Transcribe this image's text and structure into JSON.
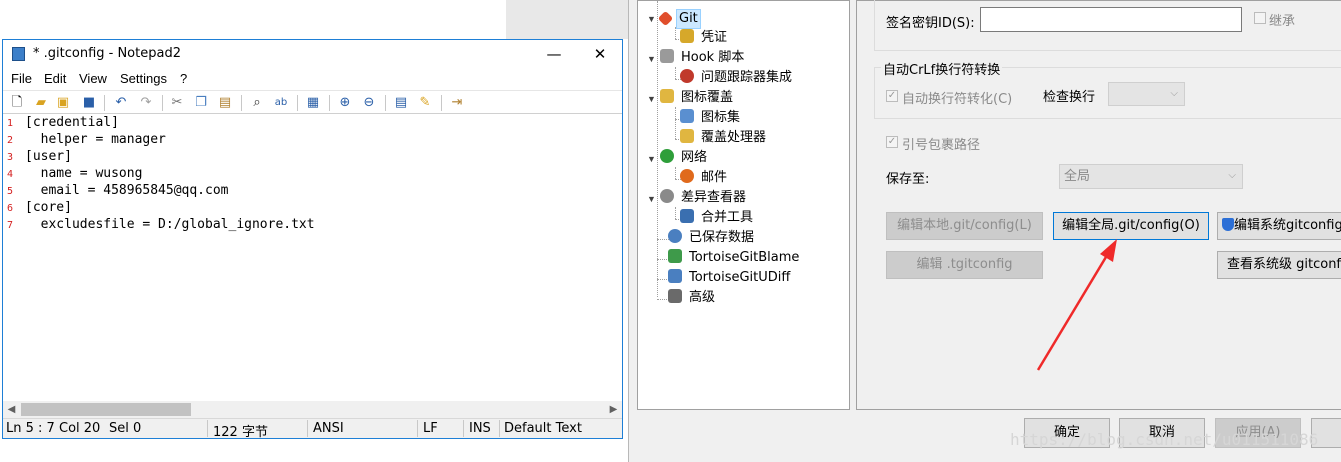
{
  "notepad": {
    "title": "* .gitconfig - Notepad2",
    "controls": {
      "minimize": "—",
      "maximize": "☐",
      "close": "✕"
    },
    "menu": [
      "File",
      "Edit",
      "View",
      "Settings",
      "?"
    ],
    "lines": [
      {
        "num": "1",
        "text": "[credential]"
      },
      {
        "num": "2",
        "text": "  helper = manager"
      },
      {
        "num": "3",
        "text": "[user]"
      },
      {
        "num": "4",
        "text": "  name = wusong"
      },
      {
        "num": "5",
        "text": "  email = 458965845@qq.com"
      },
      {
        "num": "6",
        "text": "[core]"
      },
      {
        "num": "7",
        "text": "  excludesfile = D:/global_ignore.txt"
      }
    ],
    "status": {
      "position": "Ln 5 : 7",
      "col": "Col 20",
      "sel": "Sel 0",
      "size": "122 字节",
      "encoding": "ANSI",
      "eol": "LF",
      "mode": "INS",
      "scheme": "Default Text"
    }
  },
  "tree": {
    "items": [
      {
        "label": "Git",
        "icon": "git-icon",
        "color": "#e04e2c"
      },
      {
        "label": "凭证",
        "icon": "lock-icon",
        "color": "#d6a82a"
      },
      {
        "label": "Hook 脚本",
        "icon": "hook-icon",
        "color": "#8a8a8a"
      },
      {
        "label": "问题跟踪器集成",
        "icon": "bug-icon",
        "color": "#c0392b"
      },
      {
        "label": "图标覆盖",
        "icon": "folder-overlay-icon",
        "color": "#e0b640"
      },
      {
        "label": "图标集",
        "icon": "icon-set-icon",
        "color": "#5a8fd0"
      },
      {
        "label": "覆盖处理器",
        "icon": "overlay-handler-icon",
        "color": "#e0b640"
      },
      {
        "label": "网络",
        "icon": "globe-icon",
        "color": "#2e9e3a"
      },
      {
        "label": "邮件",
        "icon": "email-icon",
        "color": "#e06a1c"
      },
      {
        "label": "差异查看器",
        "icon": "magnifier-icon",
        "color": "#707070"
      },
      {
        "label": "合并工具",
        "icon": "merge-icon",
        "color": "#3a6fb0"
      },
      {
        "label": "已保存数据",
        "icon": "gear-icon",
        "color": "#4a7fc0"
      },
      {
        "label": "TortoiseGitBlame",
        "icon": "blame-icon",
        "color": "#3e9a4a"
      },
      {
        "label": "TortoiseGitUDiff",
        "icon": "udiff-icon",
        "color": "#4a7fc0"
      },
      {
        "label": "高级",
        "icon": "wrench-icon",
        "color": "#6a6a6a"
      }
    ]
  },
  "settings": {
    "signing_key_label": "签名密钥ID(S):",
    "inherit_label": "继承",
    "autocrlf_group": "自动CrLf换行符转换",
    "autocrlf_label": "自动换行符转化(C)",
    "check_newline_label": "检查换行",
    "quote_path_label": "引号包裹路径",
    "save_to_label": "保存至:",
    "save_to_value": "全局",
    "buttons": {
      "edit_local": "编辑本地.git/config(L)",
      "edit_global": "编辑全局.git/config(O)",
      "edit_system": "编辑系统gitconfig",
      "edit_tgit": "编辑 .tgitconfig",
      "view_system": "查看系统级 gitconfig"
    }
  },
  "footer": {
    "ok": "确定",
    "cancel": "取消",
    "apply": "应用(A)"
  },
  "watermark": "https://blog.csdn.net/u011511086"
}
